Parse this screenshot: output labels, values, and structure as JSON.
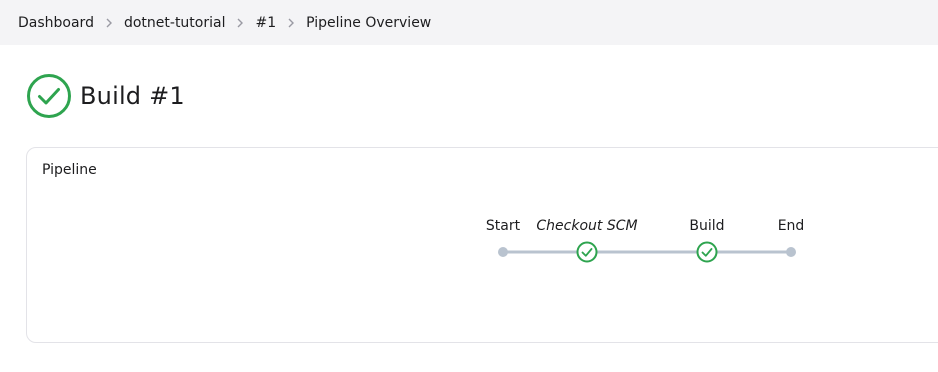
{
  "breadcrumb": {
    "items": [
      {
        "label": "Dashboard"
      },
      {
        "label": "dotnet-tutorial"
      },
      {
        "label": "#1"
      },
      {
        "label": "Pipeline Overview"
      }
    ]
  },
  "build": {
    "title": "Build #1",
    "status": "success",
    "status_icon": "check-circle-icon"
  },
  "pipeline": {
    "heading": "Pipeline",
    "stages": [
      {
        "name": "Start",
        "kind": "start"
      },
      {
        "name": "Checkout SCM",
        "kind": "stage",
        "status": "success"
      },
      {
        "name": "Build",
        "kind": "stage",
        "status": "success"
      },
      {
        "name": "End",
        "kind": "end"
      }
    ]
  },
  "colors": {
    "success": "#2ea44f",
    "connector": "#b9c3cf",
    "breadcrumb_bg": "#f4f4f6"
  }
}
